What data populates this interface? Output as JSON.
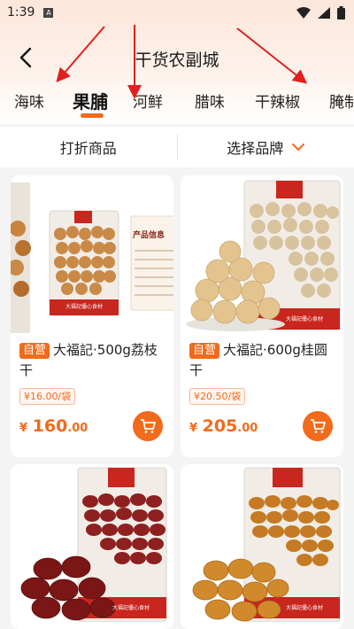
{
  "status_bar": {
    "time": "1:39",
    "notification_letter": "A"
  },
  "header": {
    "title": "干货农副城"
  },
  "tabs": [
    {
      "label": "海味"
    },
    {
      "label": "果脯"
    },
    {
      "label": "河鲜"
    },
    {
      "label": "腊味"
    },
    {
      "label": "干辣椒"
    },
    {
      "label": "腌制"
    }
  ],
  "filters": {
    "discount": "打折商品",
    "brand": "选择品牌"
  },
  "products": [
    {
      "badge": "自营",
      "title": "大福記·500g荔枝干",
      "unit_price": "¥16.00/袋",
      "price_currency": "¥",
      "price_int": "160",
      "price_dec": ".00",
      "package_label": "大福記優心食材",
      "info_card_title": "产品信息"
    },
    {
      "badge": "自营",
      "title": "大福記·600g桂圆干",
      "unit_price": "¥20.50/袋",
      "price_currency": "¥",
      "price_int": "205",
      "price_dec": ".00",
      "package_label": "大福記優心食材"
    },
    {
      "package_label": "大福記優心食材"
    },
    {
      "package_label": "大福記優心食材"
    }
  ],
  "colors": {
    "accent": "#f26a1b",
    "annotation_arrow": "#e0201c"
  }
}
